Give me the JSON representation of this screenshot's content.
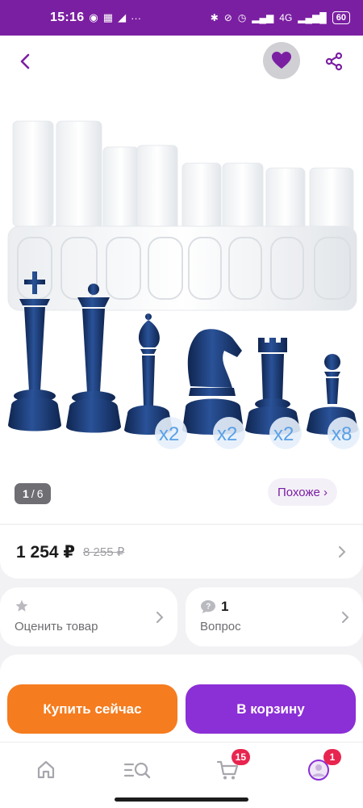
{
  "status_bar": {
    "time": "15:16",
    "network": "4G",
    "battery": "60"
  },
  "header": {
    "back_icon": "chevron-left-icon",
    "favorite_icon": "heart-icon",
    "share_icon": "share-icon"
  },
  "gallery": {
    "current_page": "1",
    "separator": "/",
    "total_pages": "6",
    "pieces": [
      {
        "piece": "king",
        "multiplier": ""
      },
      {
        "piece": "queen",
        "multiplier": ""
      },
      {
        "piece": "bishop",
        "multiplier": "x2"
      },
      {
        "piece": "knight",
        "multiplier": "x2"
      },
      {
        "piece": "rook",
        "multiplier": "x2"
      },
      {
        "piece": "pawn",
        "multiplier": "x8"
      }
    ],
    "similar_label": "Похоже ›"
  },
  "price": {
    "current": "1 254 ₽",
    "old": "8 255 ₽"
  },
  "rate_card": {
    "label": "Оценить товар",
    "icon": "star-icon"
  },
  "question_card": {
    "count": "1",
    "label": "Вопрос",
    "icon": "question-bubble-icon"
  },
  "actions": {
    "buy_now": "Купить сейчас",
    "add_to_cart": "В корзину"
  },
  "bottom_nav": {
    "items": [
      {
        "name": "home",
        "icon": "home-icon",
        "badge": ""
      },
      {
        "name": "catalog",
        "icon": "catalog-search-icon",
        "badge": ""
      },
      {
        "name": "cart",
        "icon": "cart-icon",
        "badge": "15"
      },
      {
        "name": "profile",
        "icon": "profile-icon",
        "badge": "1"
      }
    ]
  },
  "colors": {
    "brand": "#7b1fa2",
    "buy_button": "#f57c1f",
    "cart_button": "#8b2fd6",
    "badge": "#e8254f",
    "piece_blue": "#1c3a6e"
  }
}
